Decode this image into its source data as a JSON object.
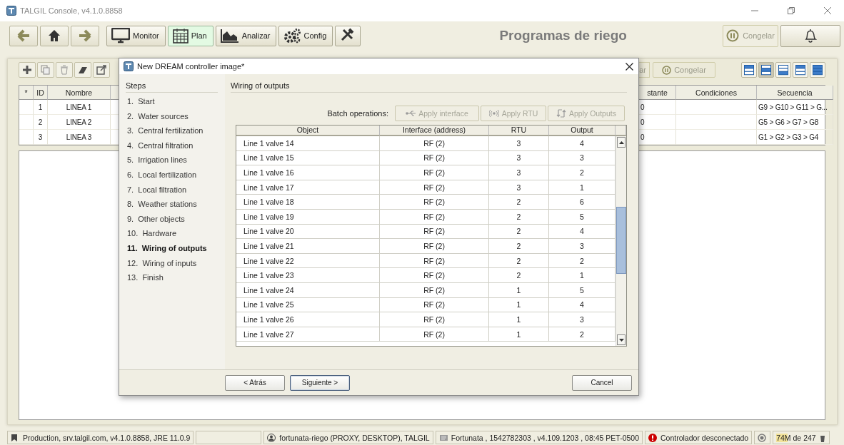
{
  "window": {
    "title": "TALGIL Console, v4.1.0.8858"
  },
  "toolbar": {
    "modules": [
      {
        "label": "Monitor",
        "kind": "monitor",
        "selected": false
      },
      {
        "label": "Plan",
        "kind": "plan",
        "selected": true
      },
      {
        "label": "Analizar",
        "kind": "analyze",
        "selected": false
      },
      {
        "label": "Config",
        "kind": "config",
        "selected": false
      },
      {
        "kind": "tools",
        "selected": false
      }
    ],
    "page_title": "Programas de riego",
    "freeze_button": "Congelar"
  },
  "subbar": {
    "cut_button": "ar",
    "freeze_button": "Congelar",
    "view_buttons": [
      {
        "selected": false
      },
      {
        "selected": true
      },
      {
        "selected": false
      },
      {
        "selected": false
      },
      {
        "selected": false
      }
    ]
  },
  "table": {
    "columns": [
      "*",
      "ID",
      "Nombre",
      "stante",
      "Condiciones",
      "Secuencia"
    ],
    "rows": [
      {
        "id": "1",
        "nombre": "LINEA 1",
        "column_4": "0",
        "secuencia": "G9 > G10 > G11 > G..."
      },
      {
        "id": "2",
        "nombre": "LINEA 2",
        "column_4": "0",
        "secuencia": "G5 > G6 > G7 > G8"
      },
      {
        "id": "3",
        "nombre": "LINEA 3",
        "column_4": "0",
        "secuencia": "G1 > G2 > G3 > G4"
      }
    ]
  },
  "dialog": {
    "title": "New DREAM controller image*",
    "steps_title": "Steps",
    "steps": [
      {
        "number": "1.",
        "label": "Start",
        "selected": false
      },
      {
        "number": "2.",
        "label": "Water sources",
        "selected": false
      },
      {
        "number": "3.",
        "label": "Central fertilization",
        "selected": false
      },
      {
        "number": "4.",
        "label": "Central filtration",
        "selected": false
      },
      {
        "number": "5.",
        "label": "Irrigation lines",
        "selected": false
      },
      {
        "number": "6.",
        "label": "Local fertilization",
        "selected": false
      },
      {
        "number": "7.",
        "label": "Local filtration",
        "selected": false
      },
      {
        "number": "8.",
        "label": "Weather stations",
        "selected": false
      },
      {
        "number": "9.",
        "label": "Other objects",
        "selected": false
      },
      {
        "number": "10.",
        "label": "Hardware",
        "selected": false
      },
      {
        "number": "11.",
        "label": "Wiring of outputs",
        "selected": true
      },
      {
        "number": "12.",
        "label": "Wiring of inputs",
        "selected": false
      },
      {
        "number": "13.",
        "label": "Finish",
        "selected": false
      }
    ],
    "section_title": "Wiring of outputs",
    "batch_label": "Batch operations:",
    "batch_buttons": [
      {
        "label": "Apply interface",
        "kind": "interface",
        "disabled": true
      },
      {
        "label": "Apply RTU",
        "kind": "rtu",
        "disabled": true
      },
      {
        "label": "Apply Outputs",
        "kind": "outputs",
        "disabled": true
      }
    ],
    "columns": [
      "Object",
      "Interface (address)",
      "RTU",
      "Output"
    ],
    "rows": [
      [
        "Line 1 valve 14",
        "RF (2)",
        "3",
        "4"
      ],
      [
        "Line 1 valve 15",
        "RF (2)",
        "3",
        "3"
      ],
      [
        "Line 1 valve 16",
        "RF (2)",
        "3",
        "2"
      ],
      [
        "Line 1 valve 17",
        "RF (2)",
        "3",
        "1"
      ],
      [
        "Line 1 valve 18",
        "RF (2)",
        "2",
        "6"
      ],
      [
        "Line 1 valve 19",
        "RF (2)",
        "2",
        "5"
      ],
      [
        "Line 1 valve 20",
        "RF (2)",
        "2",
        "4"
      ],
      [
        "Line 1 valve 21",
        "RF (2)",
        "2",
        "3"
      ],
      [
        "Line 1 valve 22",
        "RF (2)",
        "2",
        "2"
      ],
      [
        "Line 1 valve 23",
        "RF (2)",
        "2",
        "1"
      ],
      [
        "Line 1 valve 24",
        "RF (2)",
        "1",
        "5"
      ],
      [
        "Line 1 valve 25",
        "RF (2)",
        "1",
        "4"
      ],
      [
        "Line 1 valve 26",
        "RF (2)",
        "1",
        "3"
      ],
      [
        "Line 1 valve 27",
        "RF (2)",
        "1",
        "2"
      ]
    ],
    "back_button": "< Atrás",
    "next_button": "Siguiente >",
    "cancel_button": "Cancel"
  },
  "status_bar": [
    {
      "kind": "server",
      "text": "Production, srv.talgil.com, v4.1.0.8858, JRE 11.0.9"
    },
    {
      "kind": "empty"
    },
    {
      "kind": "user",
      "text": "fortunata-riego (PROXY, DESKTOP), TALGIL"
    },
    {
      "kind": "controller",
      "text": "Fortunata , 1542782303 , v4.109.1203 , 08:45 PET-0500"
    },
    {
      "kind": "alert",
      "text": "Controlador desconectado"
    },
    {
      "kind": "radio"
    },
    {
      "kind": "memory",
      "text": "74M de 247"
    }
  ]
}
